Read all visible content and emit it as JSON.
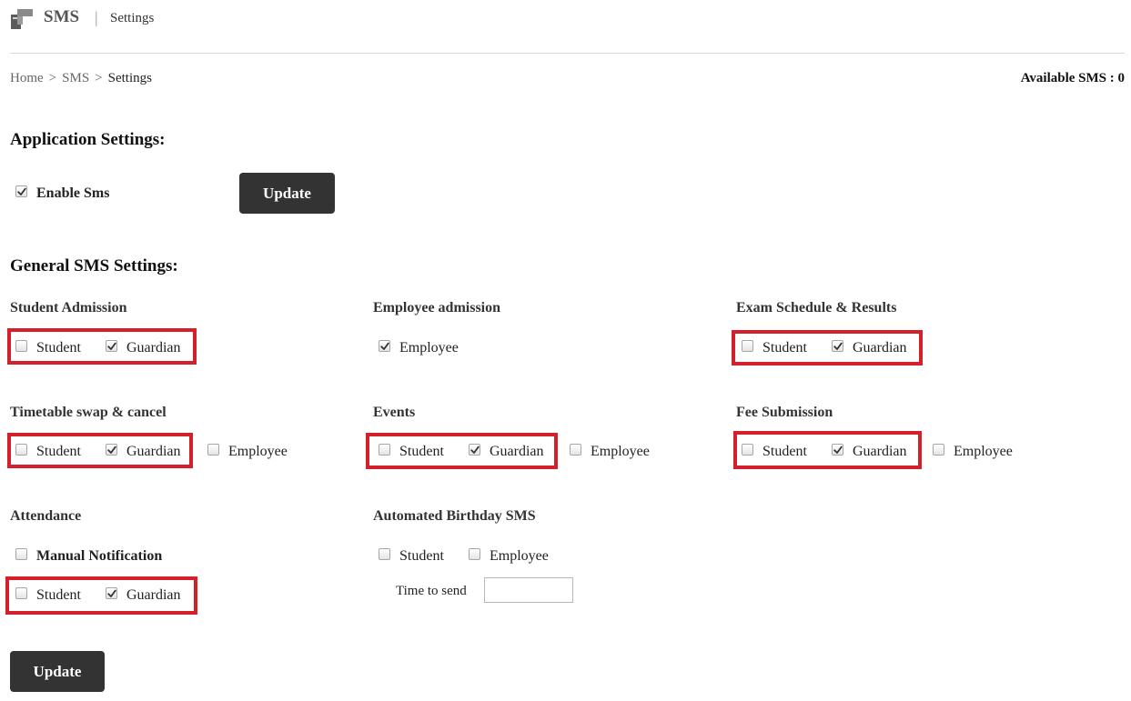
{
  "header": {
    "title": "SMS",
    "separator": "|",
    "subtitle": "Settings",
    "icon": "sms-module-icon"
  },
  "breadcrumb": {
    "items": [
      "Home",
      "SMS",
      "Settings"
    ],
    "separator": ">"
  },
  "available_sms": "Available SMS : 0",
  "application_settings": {
    "heading": "Application Settings:",
    "enable_sms": {
      "label": "Enable Sms",
      "checked": true
    },
    "update_label": "Update"
  },
  "general": {
    "heading": "General SMS Settings:",
    "student_admission": {
      "title": "Student Admission",
      "options": [
        {
          "label": "Student",
          "checked": false
        },
        {
          "label": "Guardian",
          "checked": true
        }
      ]
    },
    "employee_admission": {
      "title": "Employee admission",
      "options": [
        {
          "label": "Employee",
          "checked": true
        }
      ]
    },
    "exam_schedule": {
      "title": "Exam Schedule & Results",
      "options": [
        {
          "label": "Student",
          "checked": false
        },
        {
          "label": "Guardian",
          "checked": true
        }
      ]
    },
    "timetable": {
      "title": "Timetable swap & cancel",
      "options": [
        {
          "label": "Student",
          "checked": false
        },
        {
          "label": "Guardian",
          "checked": true
        },
        {
          "label": "Employee",
          "checked": false
        }
      ]
    },
    "events": {
      "title": "Events",
      "options": [
        {
          "label": "Student",
          "checked": false
        },
        {
          "label": "Guardian",
          "checked": true
        },
        {
          "label": "Employee",
          "checked": false
        }
      ]
    },
    "fee_submission": {
      "title": "Fee Submission",
      "options": [
        {
          "label": "Student",
          "checked": false
        },
        {
          "label": "Guardian",
          "checked": true
        },
        {
          "label": "Employee",
          "checked": false
        }
      ]
    },
    "attendance": {
      "title": "Attendance",
      "manual": {
        "label": "Manual Notification",
        "checked": false
      },
      "options": [
        {
          "label": "Student",
          "checked": false
        },
        {
          "label": "Guardian",
          "checked": true
        }
      ]
    },
    "birthday": {
      "title": "Automated Birthday SMS",
      "options": [
        {
          "label": "Student",
          "checked": false
        },
        {
          "label": "Employee",
          "checked": false
        }
      ],
      "time_label": "Time to send",
      "time_value": ""
    }
  },
  "update_label": "Update",
  "colors": {
    "button": "#333333",
    "highlight": "#d3202a"
  }
}
